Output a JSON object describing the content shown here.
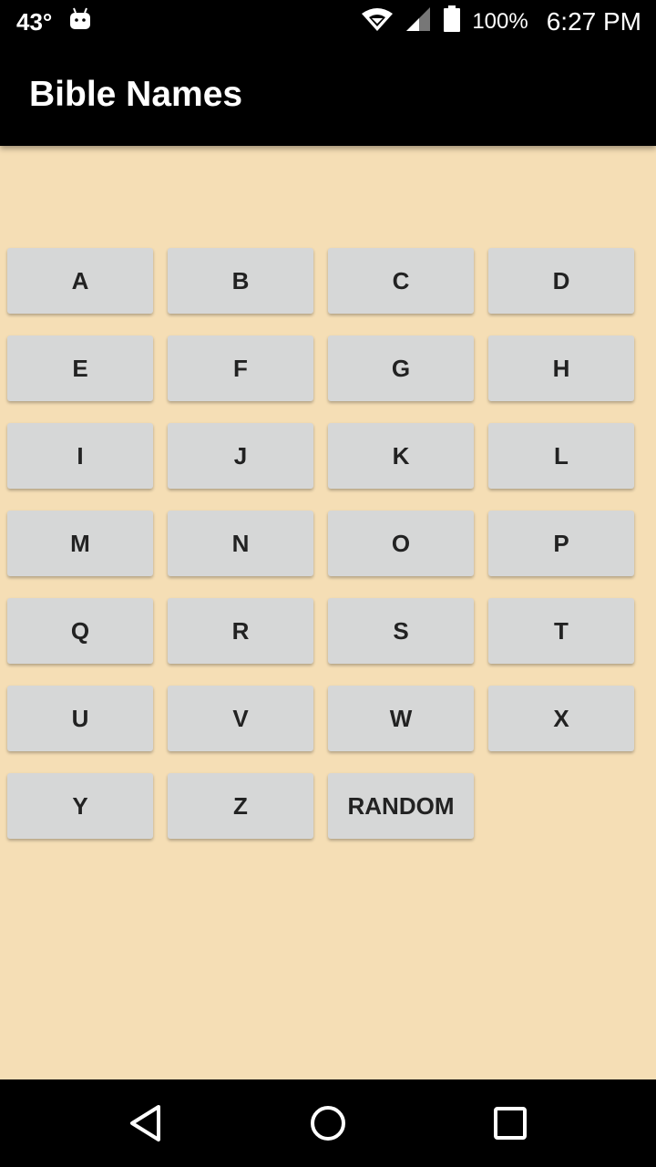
{
  "status_bar": {
    "temperature": "43°",
    "battery_percent": "100%",
    "time": "6:27 PM",
    "icons": [
      "android-icon",
      "wifi-icon",
      "signal-icon",
      "battery-icon"
    ]
  },
  "app_bar": {
    "title": "Bible Names"
  },
  "letters": [
    "A",
    "B",
    "C",
    "D",
    "E",
    "F",
    "G",
    "H",
    "I",
    "J",
    "K",
    "L",
    "M",
    "N",
    "O",
    "P",
    "Q",
    "R",
    "S",
    "T",
    "U",
    "V",
    "W",
    "X",
    "Y",
    "Z",
    "RANDOM"
  ],
  "nav_bar": {
    "icons": [
      "back-icon",
      "home-icon",
      "recents-icon"
    ]
  },
  "colors": {
    "background": "#f5deb5",
    "button": "#d6d7d7",
    "bars": "#000000"
  }
}
